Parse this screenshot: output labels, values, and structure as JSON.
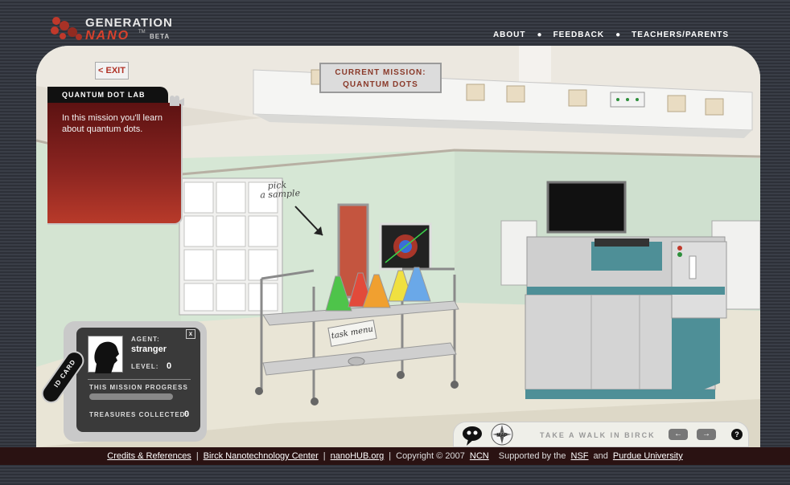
{
  "header": {
    "logo_word1": "GENERATION",
    "logo_word2": "NANO",
    "logo_tm": "TM",
    "logo_beta": "BETA",
    "nav": [
      "ABOUT",
      "FEEDBACK",
      "TEACHERS/PARENTS"
    ]
  },
  "exit_label": "< EXIT",
  "mission_sign": {
    "line1": "CURRENT MISSION:",
    "line2": "QUANTUM DOTS"
  },
  "info_panel": {
    "title": "QUANTUM DOT LAB",
    "text": "In this mission you'll learn about quantum dots."
  },
  "pick_sample": {
    "line1": "pick",
    "line2": "a sample"
  },
  "task_menu_label": "task menu",
  "id_card": {
    "tab_label": "ID CARD",
    "close": "x",
    "agent_label": "AGENT:",
    "agent_name": "stranger",
    "level_label": "LEVEL:",
    "level_value": "0",
    "progress_label": "THIS MISSION PROGRESS",
    "progress": 0,
    "treasures_label": "TREASURES COLLECTED:",
    "treasures_value": "0"
  },
  "bottom_nav": {
    "map_label": "MAP",
    "walk_label": "TAKE A WALK IN BIRCK",
    "prev": "←",
    "next": "→",
    "help": "?"
  },
  "footer": {
    "credits": "Credits & References",
    "birck": "Birck Nanotechnology Center",
    "nanohub": "nanoHUB.org",
    "copyright": "Copyright © 2007",
    "ncn": "NCN",
    "supported": "Supported by the",
    "nsf": "NSF",
    "and": "and",
    "purdue": "Purdue University",
    "sep": "|"
  },
  "colors": {
    "accent_red": "#b03226",
    "panel_red": "#8a2420",
    "machine_teal": "#4e8f97"
  }
}
